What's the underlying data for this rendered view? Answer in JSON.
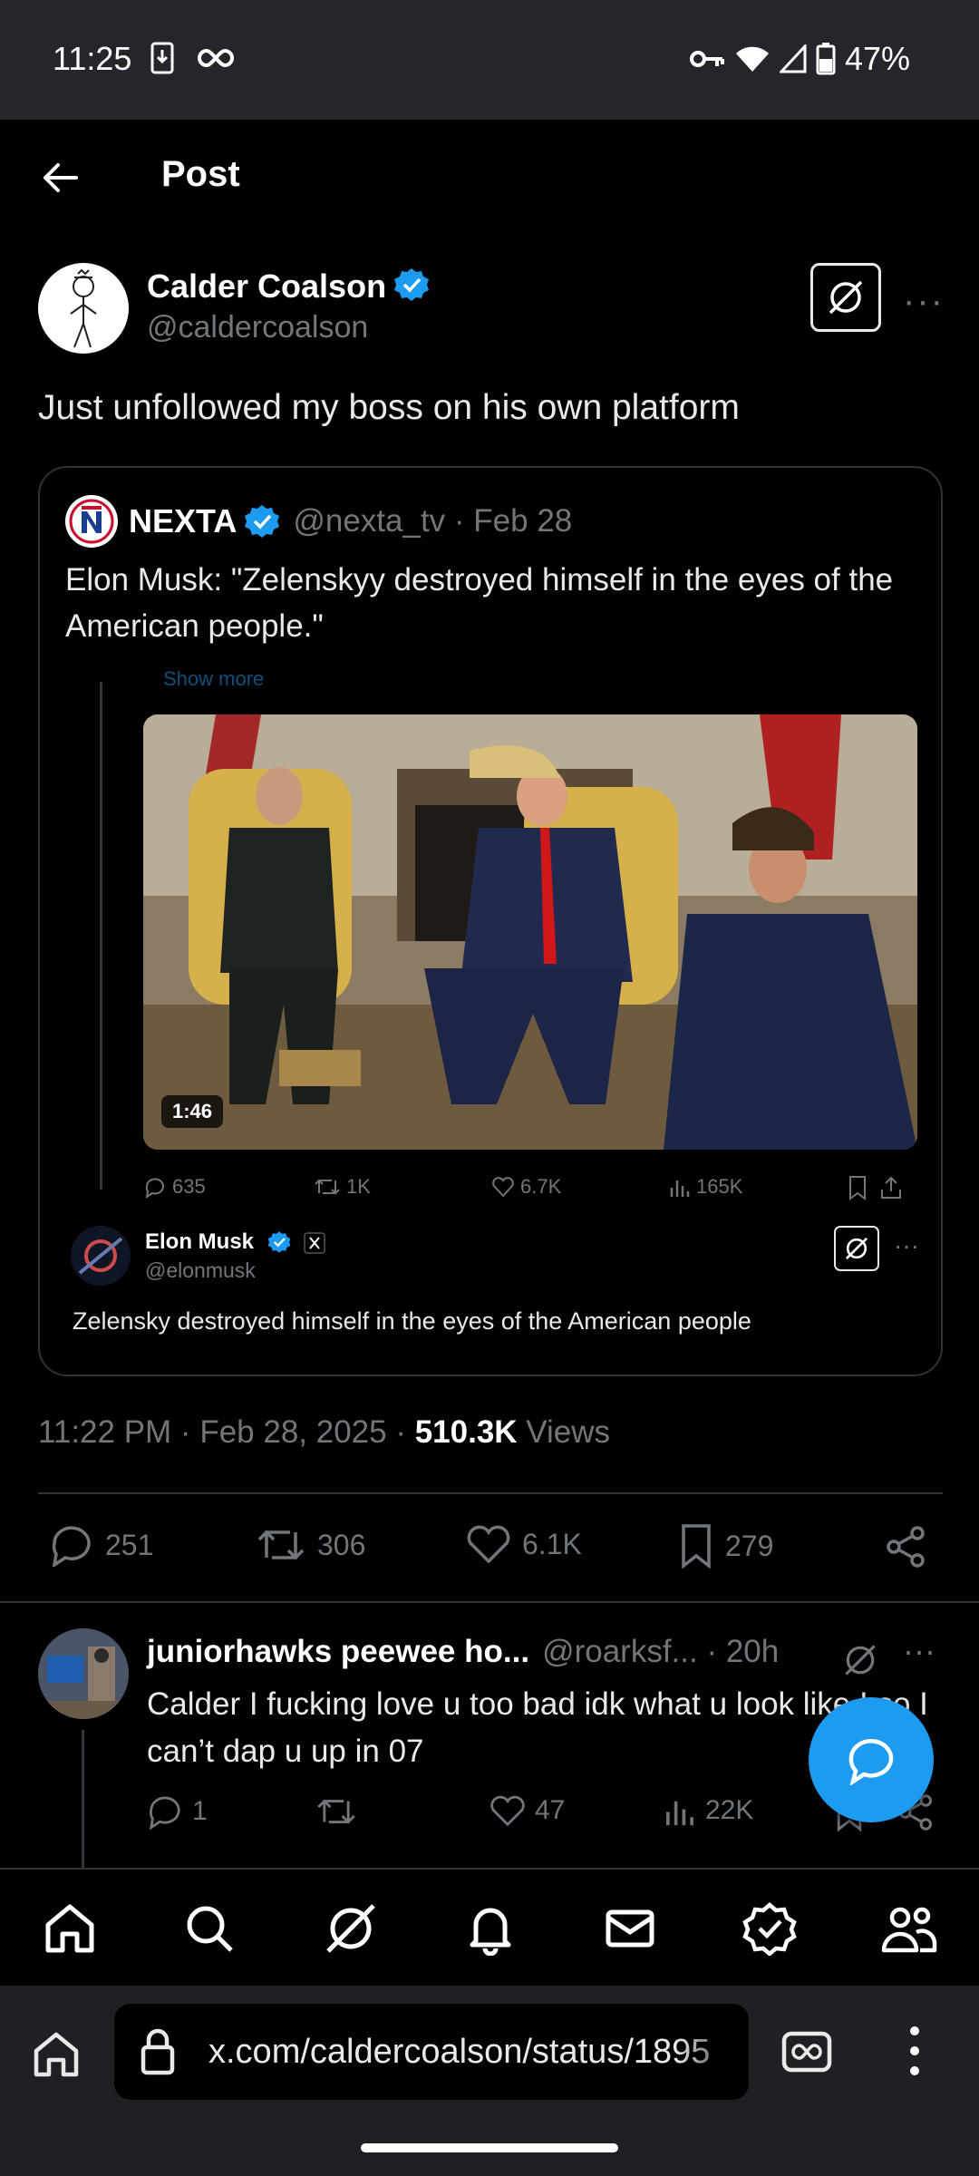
{
  "status_bar": {
    "time": "11:25",
    "battery": "47%"
  },
  "header": {
    "title": "Post"
  },
  "post": {
    "author_name": "Calder Coalson",
    "author_handle": "@caldercoalson",
    "text": "Just unfollowed my boss on his own platform",
    "timestamp": "11:22 PM · Feb 28, 2025 · ",
    "views_count": "510.3K",
    "views_label": " Views",
    "replies": "251",
    "reposts": "306",
    "likes": "6.1K",
    "bookmarks": "279"
  },
  "quoted": {
    "name": "NEXTA",
    "meta": "@nexta_tv · Feb 28",
    "text": "Elon Musk: \"Zelenskyy destroyed himself in the eyes of the American people.\"",
    "embed": {
      "show_more": "Show more",
      "duration": "1:46",
      "replies": "635",
      "reposts": "1K",
      "likes": "6.7K",
      "views": "165K",
      "user_name": "Elon Musk",
      "user_handle": "@elonmusk",
      "text": "Zelensky destroyed himself in the eyes of the American people"
    }
  },
  "reply": {
    "name": "juniorhawks peewee ho...",
    "meta": "@roarksf... · 20h",
    "text": "Calder I fucking love u too bad idk what u look like I so I can’t dap u up in 07",
    "replies": "1",
    "likes": "47",
    "views": "22K"
  },
  "browser": {
    "url": "x.com/caldercoalson/status/1895"
  },
  "colors": {
    "accent": "#1d9bf0",
    "muted": "#71767b",
    "border": "#2f3336"
  }
}
